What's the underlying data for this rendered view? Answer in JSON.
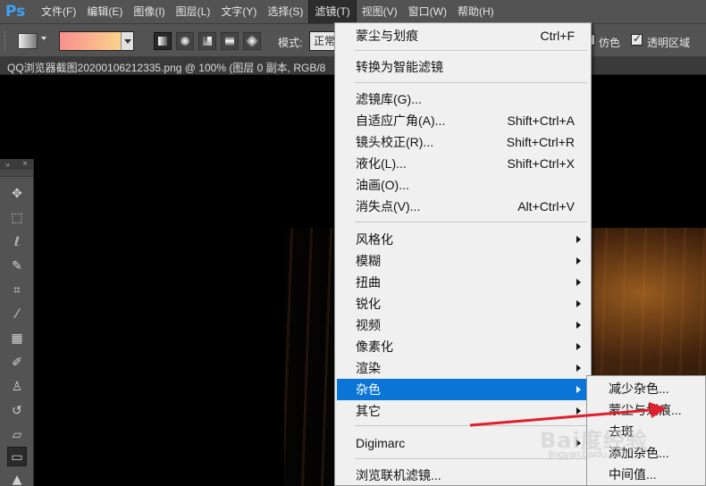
{
  "app": {
    "logo": "Ps"
  },
  "menubar": {
    "items": [
      "文件(F)",
      "编辑(E)",
      "图像(I)",
      "图层(L)",
      "文字(Y)",
      "选择(S)",
      "滤镜(T)",
      "视图(V)",
      "窗口(W)",
      "帮助(H)"
    ],
    "active_index": 6
  },
  "options": {
    "mode_label": "模式:",
    "mode_value": "正常",
    "dither_label": "仿色",
    "transparency_label": "透明区域",
    "dither_checked": true,
    "transparency_checked": true,
    "gradient_colors": [
      "#f78f8f",
      "#fce08a"
    ]
  },
  "document": {
    "tab_title": "QQ浏览器截图20200106212335.png @ 100% (图层 0 副本, RGB/8"
  },
  "tools": {
    "items": [
      "move-icon",
      "marquee-icon",
      "lasso-icon",
      "quick-select-icon",
      "crop-icon",
      "eyedropper-icon",
      "healing-icon",
      "brush-icon",
      "stamp-icon",
      "history-brush-icon",
      "eraser-icon",
      "gradient-icon",
      "blur-icon"
    ],
    "selected": "gradient-icon"
  },
  "filter_menu": {
    "items": [
      {
        "label": "蒙尘与划痕",
        "shortcut": "Ctrl+F"
      },
      {
        "label": "转换为智能滤镜"
      },
      {
        "label": "滤镜库(G)..."
      },
      {
        "label": "自适应广角(A)...",
        "shortcut": "Shift+Ctrl+A"
      },
      {
        "label": "镜头校正(R)...",
        "shortcut": "Shift+Ctrl+R"
      },
      {
        "label": "液化(L)...",
        "shortcut": "Shift+Ctrl+X"
      },
      {
        "label": "油画(O)..."
      },
      {
        "label": "消失点(V)...",
        "shortcut": "Alt+Ctrl+V"
      },
      {
        "label": "风格化"
      },
      {
        "label": "模糊"
      },
      {
        "label": "扭曲"
      },
      {
        "label": "锐化"
      },
      {
        "label": "视频"
      },
      {
        "label": "像素化"
      },
      {
        "label": "渲染"
      },
      {
        "label": "杂色",
        "highlighted": true
      },
      {
        "label": "其它"
      },
      {
        "label": "Digimarc"
      },
      {
        "label": "浏览联机滤镜..."
      }
    ]
  },
  "noise_submenu": {
    "items": [
      "减少杂色...",
      "蒙尘与划痕...",
      "去斑",
      "添加杂色...",
      "中间值..."
    ]
  },
  "watermark": {
    "text": "Bai度经验",
    "sub": "jingyan.baidu.com"
  },
  "colors": {
    "highlight": "#0a74d7",
    "annotation": "#e0202c"
  }
}
